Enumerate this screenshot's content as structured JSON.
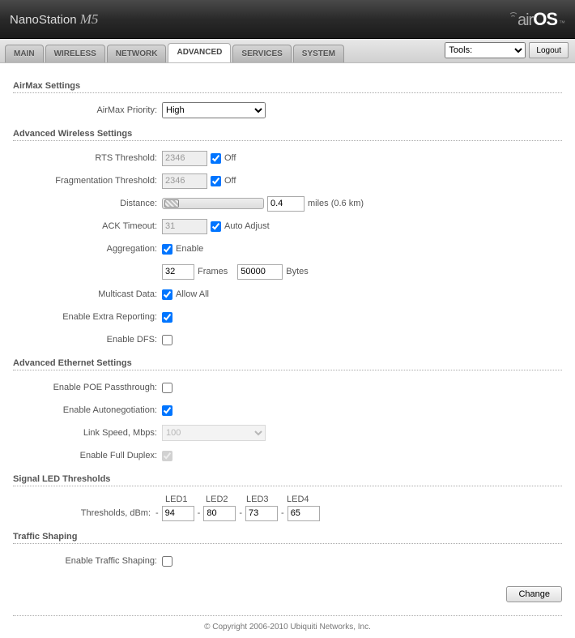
{
  "header": {
    "product": "NanoStation",
    "model": "M5",
    "logo_air": "air",
    "logo_os": "OS",
    "logo_tm": "™"
  },
  "tabs": {
    "main": "MAIN",
    "wireless": "WIRELESS",
    "network": "NETWORK",
    "advanced": "ADVANCED",
    "services": "SERVICES",
    "system": "SYSTEM"
  },
  "toolbar": {
    "tools_label": "Tools:",
    "logout_label": "Logout"
  },
  "sections": {
    "airmax": "AirMax Settings",
    "wireless": "Advanced Wireless Settings",
    "ethernet": "Advanced Ethernet Settings",
    "led": "Signal LED Thresholds",
    "traffic": "Traffic Shaping"
  },
  "airmax": {
    "priority_label": "AirMax Priority:",
    "priority_value": "High"
  },
  "wireless": {
    "rts_label": "RTS Threshold:",
    "rts_value": "2346",
    "frag_label": "Fragmentation Threshold:",
    "frag_value": "2346",
    "off_label": "Off",
    "distance_label": "Distance:",
    "distance_value": "0.4",
    "distance_unit": "miles (0.6 km)",
    "ack_label": "ACK Timeout:",
    "ack_value": "31",
    "auto_adjust_label": "Auto Adjust",
    "aggregation_label": "Aggregation:",
    "enable_label": "Enable",
    "agg_frames_value": "32",
    "agg_frames_label": "Frames",
    "agg_bytes_value": "50000",
    "agg_bytes_label": "Bytes",
    "multicast_label": "Multicast Data:",
    "allow_all_label": "Allow All",
    "extra_reporting_label": "Enable Extra Reporting:",
    "dfs_label": "Enable DFS:"
  },
  "ethernet": {
    "poe_label": "Enable POE Passthrough:",
    "autoneg_label": "Enable Autonegotiation:",
    "linkspeed_label": "Link Speed, Mbps:",
    "linkspeed_value": "100",
    "fullduplex_label": "Enable Full Duplex:"
  },
  "led": {
    "led1": "LED1",
    "led2": "LED2",
    "led3": "LED3",
    "led4": "LED4",
    "thresholds_label": "Thresholds, dBm:",
    "dash": "-",
    "v1": "94",
    "v2": "80",
    "v3": "73",
    "v4": "65"
  },
  "traffic": {
    "enable_label": "Enable Traffic Shaping:"
  },
  "buttons": {
    "change": "Change"
  },
  "footer": "© Copyright 2006-2010 Ubiquiti Networks, Inc."
}
